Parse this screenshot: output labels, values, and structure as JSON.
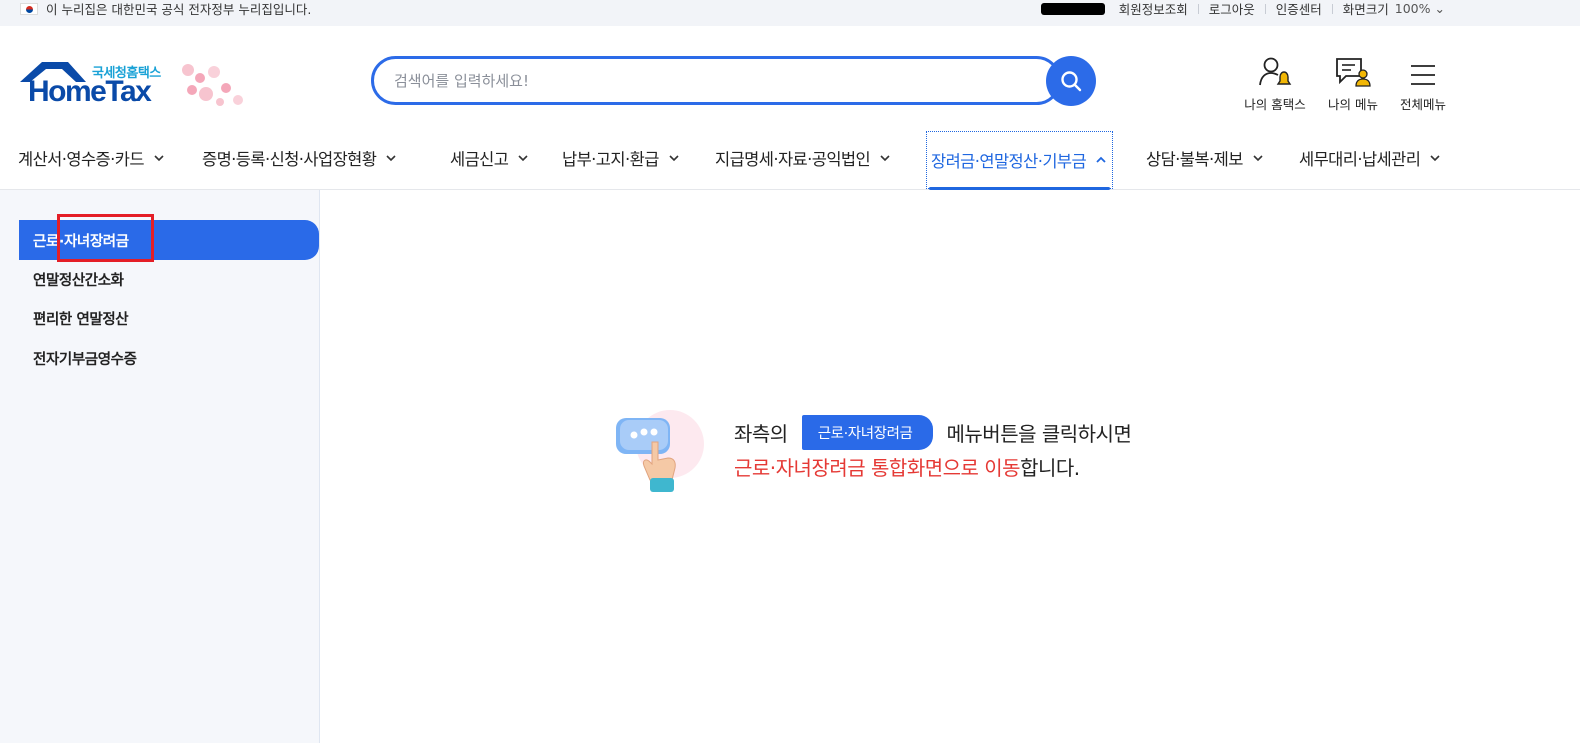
{
  "gov_notice": "이 누리집은 대한민국 공식 전자정부 누리집입니다.",
  "util_links": [
    "회원정보조회",
    "로그아웃",
    "인증센터",
    "화면크기"
  ],
  "zoom_level": "100%",
  "logo": {
    "sub": "국세청홈택스",
    "main": "HomeTax"
  },
  "search": {
    "placeholder": "검색어를 입력하세요!"
  },
  "header_icons": {
    "my_hometax": "나의 홈택스",
    "my_menu": "나의 메뉴",
    "all_menu": "전체메뉴"
  },
  "gnb": [
    "계산서·영수증·카드",
    "증명·등록·신청·사업장현황",
    "세금신고",
    "납부·고지·환급",
    "지급명세·자료·공익법인",
    "장려금·연말정산·기부금",
    "상담·불복·제보",
    "세무대리·납세관리"
  ],
  "lnb": [
    "근로·자녀장려금",
    "연말정산간소화",
    "편리한 연말정산",
    "전자기부금영수증"
  ],
  "guide": {
    "prefix": "좌측의",
    "button_label": "근로·자녀장려금",
    "suffix": "메뉴버튼을 클릭하시면",
    "highlight": "근로·자녀장려금 통합화면으로 이동",
    "end": "합니다."
  },
  "colors": {
    "primary": "#2a6ae8",
    "highlight_red": "#e53935",
    "annotation_red": "#e41e26"
  }
}
